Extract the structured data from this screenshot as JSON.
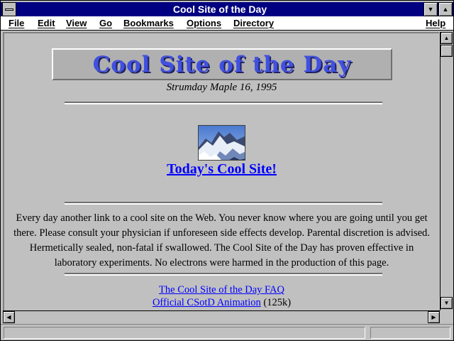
{
  "window": {
    "title": "Cool Site of the Day"
  },
  "menu": {
    "items": [
      "File",
      "Edit",
      "View",
      "Go",
      "Bookmarks",
      "Options",
      "Directory"
    ],
    "help": "Help"
  },
  "page": {
    "banner_text": "Cool Site of the Day",
    "date": "Strumday Maple 16, 1995",
    "today_link": "Today's Cool Site!",
    "paragraph": "Every day another link to a cool site on the Web. You never know where you are going until you get there. Please consult your physician if unforeseen side effects develop. Parental discretion is advised. Hermetically sealed, non-fatal if swallowed. The Cool Site of the Day has proven effective in laboratory experiments. No electrons were harmed in the production of this page.",
    "faq_link": "The Cool Site of the Day FAQ",
    "animation_link": "Official CSotD Animation",
    "animation_size": "(125k)"
  },
  "icons": {
    "system_menu": "system-menu-icon",
    "minimize": "triangle-down-icon",
    "maximize": "triangle-up-icon",
    "scroll_up": "arrow-up-icon",
    "scroll_down": "arrow-down-icon",
    "scroll_left": "arrow-left-icon",
    "scroll_right": "arrow-right-icon"
  },
  "colors": {
    "titlebar": "#000080",
    "link": "#0000ff",
    "background": "#c0c0c0"
  }
}
